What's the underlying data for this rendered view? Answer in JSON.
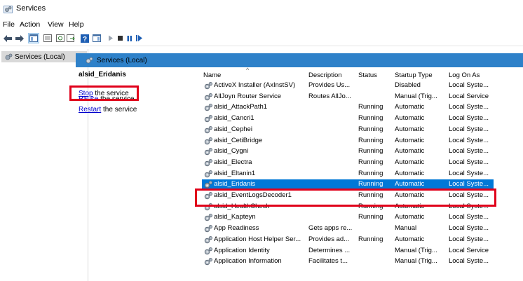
{
  "window": {
    "title": "Services",
    "app_icon": "services-gear-icon"
  },
  "menu": [
    "File",
    "Action",
    "View",
    "Help"
  ],
  "toolbar_icons": [
    "back-arrow-icon",
    "forward-arrow-icon",
    "console-tree-icon",
    "properties-icon",
    "refresh-icon",
    "export-icon",
    "help-icon",
    "show-hide-icon",
    "play-icon",
    "stop-icon",
    "pause-icon",
    "restart-icon"
  ],
  "tree": {
    "root_label": "Services (Local)"
  },
  "tab": {
    "label": "Services (Local)"
  },
  "left_pane": {
    "service_title": "alsid_Eridanis",
    "stop_link": "Stop",
    "stop_suffix": " the service",
    "pause_link": "Pause",
    "pause_suffix": " the service",
    "restart_link": "Restart",
    "restart_suffix": " the service"
  },
  "columns": {
    "name": "Name",
    "description": "Description",
    "status": "Status",
    "startup_type": "Startup Type",
    "log_on_as": "Log On As"
  },
  "selected_index": 9,
  "services": [
    {
      "name": "ActiveX Installer (AxInstSV)",
      "description": "Provides Us...",
      "status": "",
      "startup": "Disabled",
      "logon": "Local Syste..."
    },
    {
      "name": "AllJoyn Router Service",
      "description": "Routes AllJo...",
      "status": "",
      "startup": "Manual (Trig...",
      "logon": "Local Service"
    },
    {
      "name": "alsid_AttackPath1",
      "description": "",
      "status": "Running",
      "startup": "Automatic",
      "logon": "Local Syste..."
    },
    {
      "name": "alsid_Cancri1",
      "description": "",
      "status": "Running",
      "startup": "Automatic",
      "logon": "Local Syste..."
    },
    {
      "name": "alsid_Cephei",
      "description": "",
      "status": "Running",
      "startup": "Automatic",
      "logon": "Local Syste..."
    },
    {
      "name": "alsid_CetiBridge",
      "description": "",
      "status": "Running",
      "startup": "Automatic",
      "logon": "Local Syste..."
    },
    {
      "name": "alsid_Cygni",
      "description": "",
      "status": "Running",
      "startup": "Automatic",
      "logon": "Local Syste..."
    },
    {
      "name": "alsid_Electra",
      "description": "",
      "status": "Running",
      "startup": "Automatic",
      "logon": "Local Syste..."
    },
    {
      "name": "alsid_Eltanin1",
      "description": "",
      "status": "Running",
      "startup": "Automatic",
      "logon": "Local Syste..."
    },
    {
      "name": "alsid_Eridanis",
      "description": "",
      "status": "Running",
      "startup": "Automatic",
      "logon": "Local Syste..."
    },
    {
      "name": "alsid_EventLogsDecoder1",
      "description": "",
      "status": "Running",
      "startup": "Automatic",
      "logon": "Local Syste..."
    },
    {
      "name": "alsid_HealthCheck",
      "description": "",
      "status": "Running",
      "startup": "Automatic",
      "logon": "Local Syste..."
    },
    {
      "name": "alsid_Kapteyn",
      "description": "",
      "status": "Running",
      "startup": "Automatic",
      "logon": "Local Syste..."
    },
    {
      "name": "App Readiness",
      "description": "Gets apps re...",
      "status": "",
      "startup": "Manual",
      "logon": "Local Syste..."
    },
    {
      "name": "Application Host Helper Ser...",
      "description": "Provides ad...",
      "status": "Running",
      "startup": "Automatic",
      "logon": "Local Syste..."
    },
    {
      "name": "Application Identity",
      "description": "Determines ...",
      "status": "",
      "startup": "Manual (Trig...",
      "logon": "Local Service"
    },
    {
      "name": "Application Information",
      "description": "Facilitates t...",
      "status": "",
      "startup": "Manual (Trig...",
      "logon": "Local Syste..."
    }
  ],
  "colors": {
    "selection": "#0078d7",
    "tab_header": "#2e81c9",
    "highlight_box": "#e0001a",
    "link": "#0000cc"
  }
}
